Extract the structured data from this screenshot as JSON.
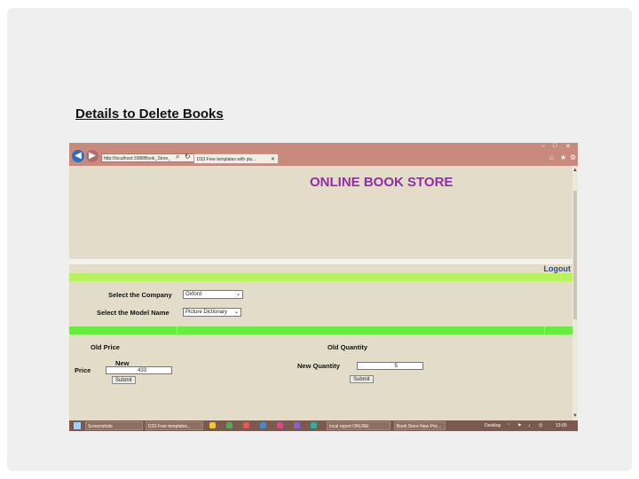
{
  "slide": {
    "title": "Details to Delete Books"
  },
  "browser": {
    "address": "http://localhost:1988/Book_Store_",
    "tab_label": "D33 Free templates with plu...",
    "window_controls": [
      "–",
      "□",
      "✕"
    ],
    "toolbar_icons": [
      "home-icon",
      "star-icon",
      "gear-icon"
    ]
  },
  "page": {
    "store_title": "ONLINE BOOK STORE",
    "logout": "Logout",
    "select_company_label": "Select the Company",
    "company_value": "Oxford",
    "select_model_label": "Select the Model Name",
    "model_value": "Picture Dictionary",
    "old_price_label": "Old Price",
    "old_quantity_label": "Old Quantity",
    "price_label": "Price",
    "new_label": "New",
    "new_price_value": "433",
    "new_quantity_label": "New Quantity",
    "new_quantity_value": "5",
    "submit_label": "Submit"
  },
  "taskbar": {
    "items": [
      "Screenshots",
      "D33 Free templates...",
      "local report ONLINE",
      "Book Store New Pric..."
    ],
    "desktop_label": "Desktop",
    "clock": "13:00"
  },
  "colors": {
    "store_title": "#8e2ea8",
    "lime_bar": "#b8f25a",
    "green_bar": "#66ee3c",
    "logout": "#1f4ea8"
  }
}
